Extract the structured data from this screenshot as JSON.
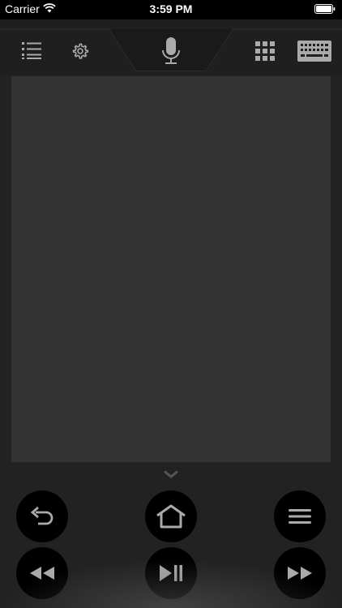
{
  "status_bar": {
    "carrier": "Carrier",
    "time": "3:59 PM",
    "wifi_icon": "wifi-icon",
    "battery_icon": "battery-icon"
  },
  "toolbar": {
    "left_buttons": [
      {
        "name": "list-button",
        "icon": "list-icon"
      },
      {
        "name": "settings-button",
        "icon": "gear-icon"
      }
    ],
    "center_button": {
      "name": "voice-button",
      "icon": "microphone-icon"
    },
    "right_buttons": [
      {
        "name": "numpad-button",
        "icon": "grid-icon"
      },
      {
        "name": "keyboard-button",
        "icon": "keyboard-icon"
      }
    ]
  },
  "touchpad": {
    "icon": "touchpad-area"
  },
  "collapse": {
    "icon": "chevron-down-icon"
  },
  "controls": {
    "row1": [
      {
        "name": "back-button",
        "icon": "back-arrow-icon"
      },
      {
        "name": "home-button",
        "icon": "home-icon"
      },
      {
        "name": "menu-button",
        "icon": "hamburger-icon"
      }
    ],
    "row2": [
      {
        "name": "rewind-button",
        "icon": "rewind-icon"
      },
      {
        "name": "play-pause-button",
        "icon": "play-pause-icon"
      },
      {
        "name": "fast-forward-button",
        "icon": "fast-forward-icon"
      }
    ]
  },
  "colors": {
    "background": "#222222",
    "toolbar": "#1f1f1f",
    "touchpad": "#333333",
    "icon": "#aaaaaa",
    "button": "#000000"
  }
}
